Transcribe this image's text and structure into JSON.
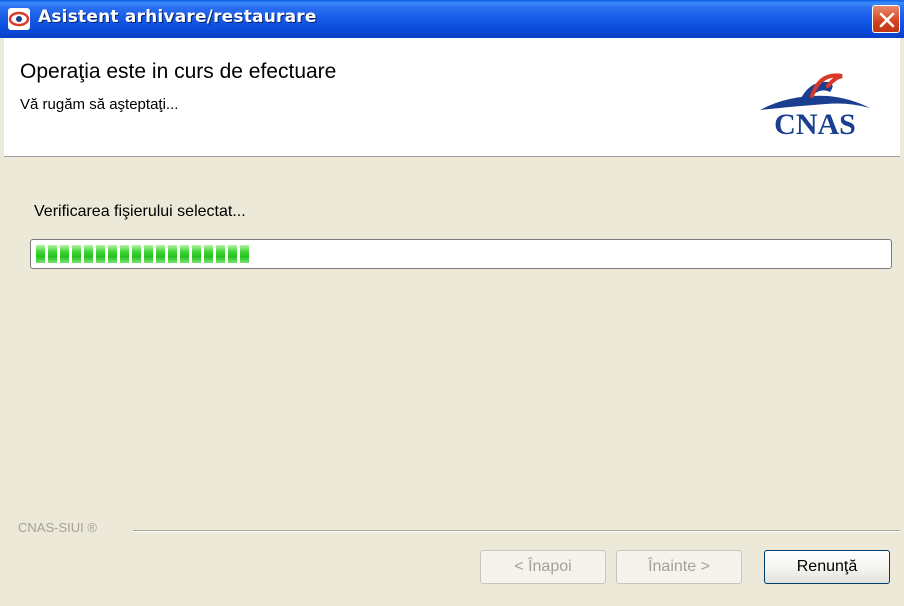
{
  "window": {
    "title": "Asistent arhivare/restaurare"
  },
  "header": {
    "title": "Operaţia este in curs de efectuare",
    "subtitle": "Vă rugăm să aşteptaţi...",
    "logo_text": "CNAS"
  },
  "main": {
    "status": "Verificarea fişierului selectat...",
    "progress": 0.26
  },
  "footer": {
    "label": "CNAS-SIUI ®",
    "back_label": "< Înapoi",
    "next_label": "Înainte >",
    "cancel_label": "Renunţă"
  },
  "colors": {
    "titlebar": "#1157e6",
    "progress_fill": "#22c11c",
    "logo": "#1a3f8f"
  }
}
